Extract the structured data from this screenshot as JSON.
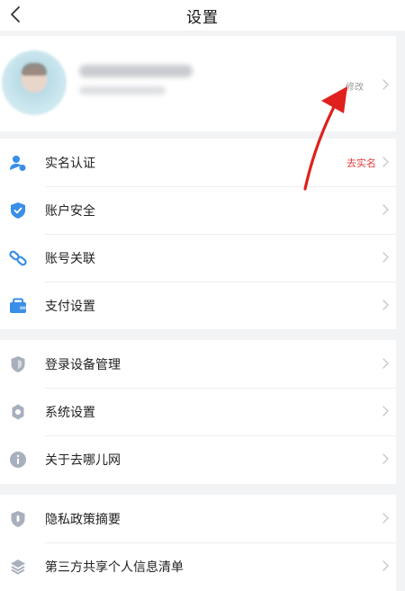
{
  "nav": {
    "title": "设置",
    "back_icon": "chevron-left-icon"
  },
  "profile": {
    "avatar_icon": "avatar",
    "nickname": "",
    "edit_label": "修改"
  },
  "groups": [
    {
      "items": [
        {
          "label": "实名认证",
          "value": "去实名",
          "icon": "user-verify-icon"
        },
        {
          "label": "账户安全",
          "value": "",
          "icon": "shield-check-icon"
        },
        {
          "label": "账号关联",
          "value": "",
          "icon": "link-icon"
        },
        {
          "label": "支付设置",
          "value": "",
          "icon": "wallet-icon"
        }
      ]
    },
    {
      "items": [
        {
          "label": "登录设备管理",
          "value": "",
          "icon": "device-shield-icon"
        },
        {
          "label": "系统设置",
          "value": "",
          "icon": "gear-icon"
        },
        {
          "label": "关于去哪儿网",
          "value": "",
          "icon": "info-icon"
        }
      ]
    },
    {
      "items": [
        {
          "label": "隐私政策摘要",
          "value": "",
          "icon": "privacy-shield-icon"
        },
        {
          "label": "第三方共享个人信息清单",
          "value": "",
          "icon": "layers-icon"
        }
      ]
    }
  ],
  "colors": {
    "accent_blue": "#3a8ee6",
    "icon_grey": "#a9b0bd",
    "warn_red": "#e23d3d",
    "annotation_arrow": "#e0201c"
  }
}
